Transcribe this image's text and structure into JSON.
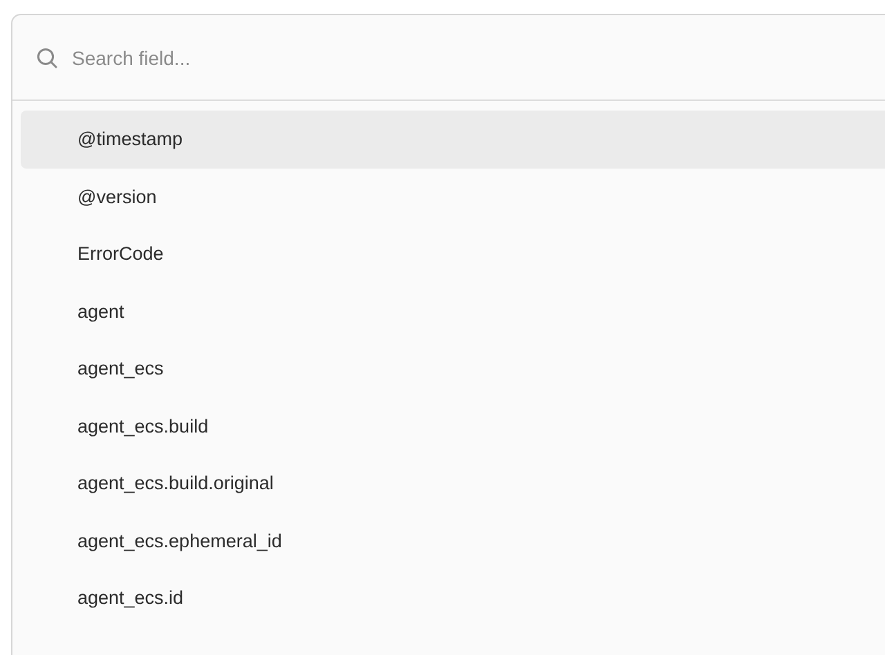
{
  "search": {
    "placeholder": "Search field..."
  },
  "fields": [
    {
      "name": "@timestamp",
      "selected": true
    },
    {
      "name": "@version",
      "selected": false
    },
    {
      "name": "ErrorCode",
      "selected": false
    },
    {
      "name": "agent",
      "selected": false
    },
    {
      "name": "agent_ecs",
      "selected": false
    },
    {
      "name": "agent_ecs.build",
      "selected": false
    },
    {
      "name": "agent_ecs.build.original",
      "selected": false
    },
    {
      "name": "agent_ecs.ephemeral_id",
      "selected": false
    },
    {
      "name": "agent_ecs.id",
      "selected": false
    }
  ]
}
